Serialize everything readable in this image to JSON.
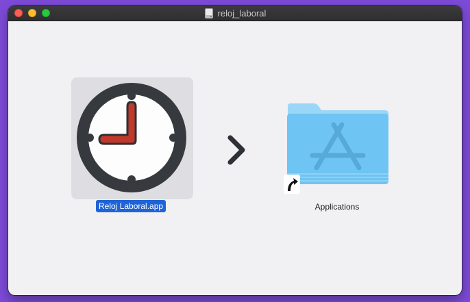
{
  "window": {
    "title": "reloj_laboral",
    "title_icon": "disk-image-icon"
  },
  "items": {
    "app": {
      "label": "Reloj Laboral.app",
      "icon": "clock-icon",
      "selected": true
    },
    "arrow_icon": "chevron-right-icon",
    "applications": {
      "label": "Applications",
      "icon": "applications-folder-icon",
      "alias_icon": "alias-arrow-icon"
    }
  },
  "colors": {
    "desktop": "#7D4BD8",
    "window_bg": "#F1F0F3",
    "selection": "#1F64D6",
    "clock_hands": "#C0392B",
    "folder": "#6EC4F2"
  }
}
